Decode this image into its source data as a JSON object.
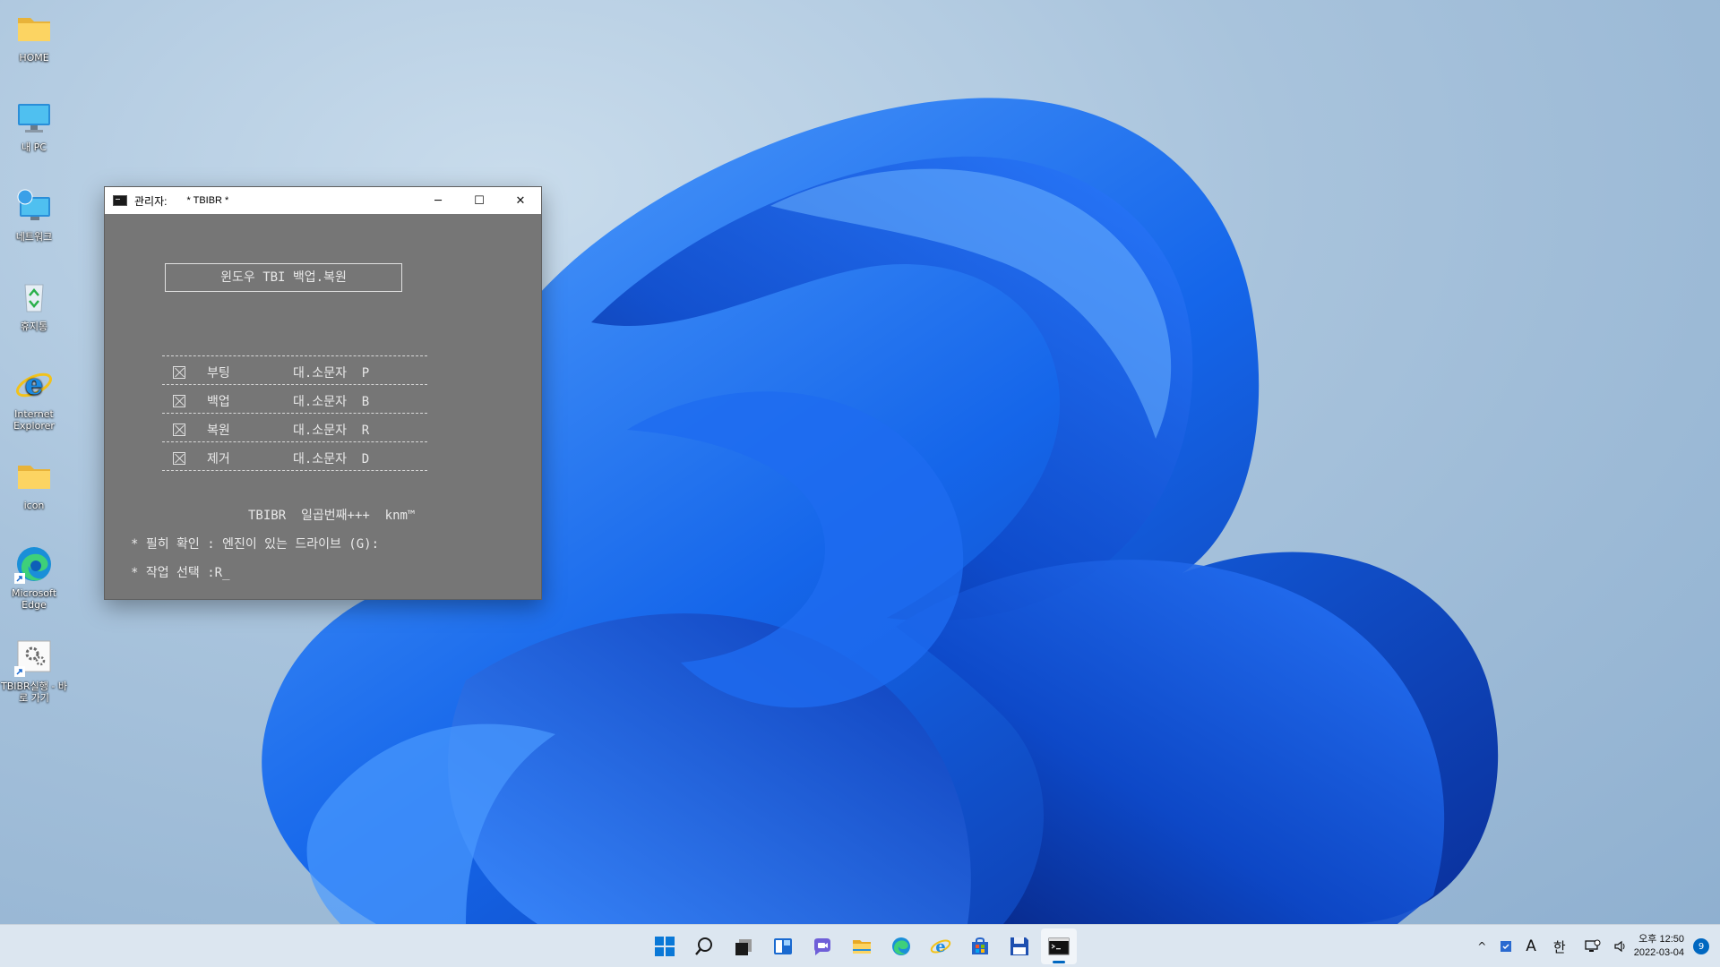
{
  "desktop": {
    "icons": [
      {
        "label": "HOME",
        "icon": "folder-icon"
      },
      {
        "label": "내 PC",
        "icon": "monitor-icon"
      },
      {
        "label": "네트워크",
        "icon": "network-icon"
      },
      {
        "label": "휴지통",
        "icon": "recycle-bin-icon"
      },
      {
        "label": "Internet Explorer",
        "icon": "internet-explorer-icon"
      },
      {
        "label": "icon",
        "icon": "folder-icon"
      },
      {
        "label": "Microsoft Edge",
        "icon": "edge-icon"
      },
      {
        "label": "TBIBR실행 - 바로 가기",
        "icon": "shortcut-settings-icon"
      }
    ]
  },
  "console": {
    "title_prefix": "관리자:",
    "title": "* TBIBR *",
    "controls": {
      "minimize": "─",
      "maximize": "☐",
      "close": "✕"
    },
    "header_box": "윈도우  TBI 백업.복원",
    "menu": [
      {
        "name": "부팅",
        "key": "대.소문자  P"
      },
      {
        "name": "백업",
        "key": "대.소문자  B"
      },
      {
        "name": "복원",
        "key": "대.소문자  R"
      },
      {
        "name": "제거",
        "key": "대.소문자  D"
      }
    ],
    "credit": "TBIBR  일곱번째+++  knm™",
    "notice": "* 필히 확인 : 엔진이 있는 드라이브 (G):",
    "prompt": "* 작업 선택 :R_"
  },
  "taskbar": {
    "apps": [
      "start-icon",
      "search-icon",
      "task-view-icon",
      "widgets-icon",
      "chat-icon",
      "file-explorer-icon",
      "edge-icon",
      "internet-explorer-icon",
      "store-icon",
      "save-disk-icon",
      "terminal-icon"
    ],
    "tray": {
      "chevron": "^",
      "ime_a": "A",
      "ime_han": "한",
      "time": "오후 12:50",
      "date": "2022-03-04",
      "notifications": "9"
    }
  },
  "colors": {
    "console_bg": "#767676",
    "accent": "#0067c0",
    "wallpaper_bloom": "#1a5fe0"
  }
}
